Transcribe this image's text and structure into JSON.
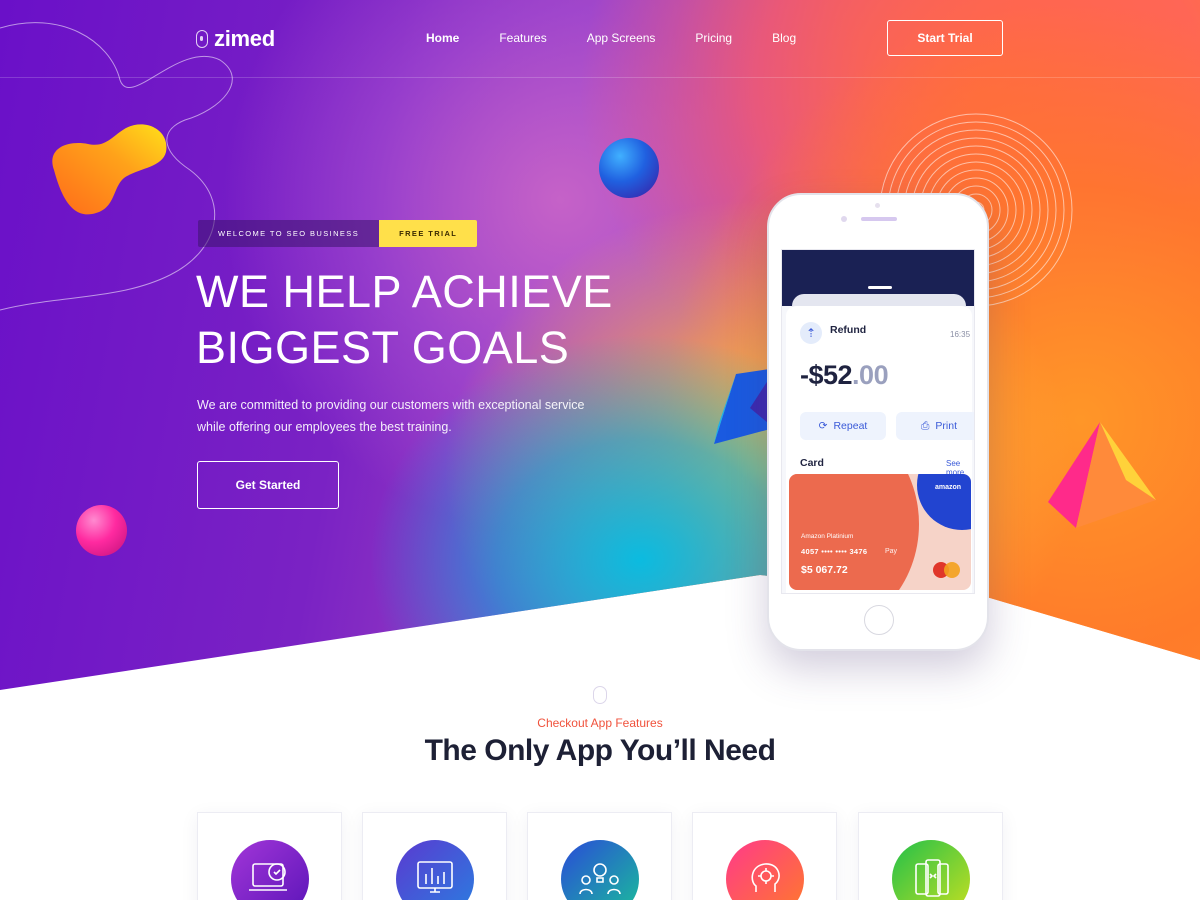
{
  "brand": {
    "name": "zimed"
  },
  "nav": {
    "items": [
      {
        "label": "Home",
        "active": true
      },
      {
        "label": "Features",
        "active": false
      },
      {
        "label": "App Screens",
        "active": false
      },
      {
        "label": "Pricing",
        "active": false
      },
      {
        "label": "Blog",
        "active": false
      }
    ],
    "cta_label": "Start Trial"
  },
  "hero": {
    "badge_welcome": "WELCOME TO SEO BUSINESS",
    "badge_trial": "FREE TRIAL",
    "title_line1": "WE HELP ACHIEVE",
    "title_line2": "BIGGEST GOALS",
    "description_line1": "We are committed to providing our customers with exceptional service",
    "description_line2": "while offering our employees the best training.",
    "button_label": "Get Started"
  },
  "phone": {
    "refund_label": "Refund",
    "time": "16:35",
    "amount_main": "-$52",
    "amount_cents": ".00",
    "repeat_label": "Repeat",
    "print_label": "Print",
    "card_label": "Card",
    "see_more": "See more",
    "card": {
      "brand": "amazon",
      "name": "Amazon Platinium",
      "number": "4057 •••• •••• 3476",
      "pay": "Pay",
      "balance": "$5 067.72"
    }
  },
  "features": {
    "subtitle": "Checkout App Features",
    "title": "The Only App You’ll Need",
    "cards": [
      {
        "icon": "devices-icon"
      },
      {
        "icon": "monitor-chart-icon"
      },
      {
        "icon": "team-idea-icon"
      },
      {
        "icon": "brain-gear-icon"
      },
      {
        "icon": "mobile-apps-icon"
      }
    ]
  },
  "colors": {
    "accent": "#f0523c",
    "badge_yellow": "#ffe04a",
    "heading_dark": "#1d2035",
    "phone_link": "#3a5ad8"
  }
}
